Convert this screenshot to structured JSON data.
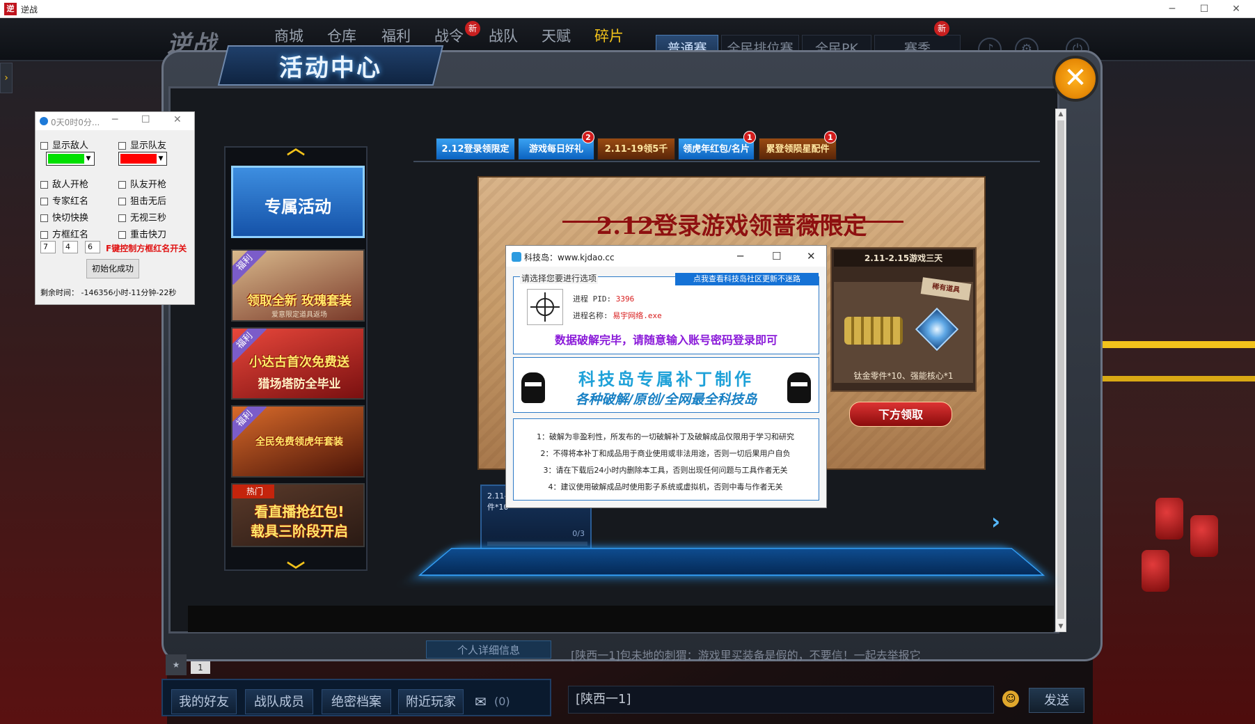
{
  "window": {
    "title": "逆战",
    "icon_text": "逆",
    "min": "─",
    "max": "☐",
    "close": "✕"
  },
  "topnav": {
    "logo": "逆战",
    "items": [
      "商城",
      "仓库",
      "福利",
      "战令",
      "战队",
      "天赋",
      "碎片"
    ],
    "new_badge": "新",
    "modes": [
      "普通赛",
      "全民排位赛",
      "全民PK",
      "赛季"
    ]
  },
  "activity": {
    "title": "活动中心",
    "close": "✕",
    "side": {
      "selected": "专属活动",
      "items": [
        {
          "tag": "福利",
          "text": "领取全新 玫瑰套装",
          "sub": "爱意限定道具返场"
        },
        {
          "tag": "福利",
          "text": "小达古首次免费送",
          "sub": "猎场塔防全毕业"
        },
        {
          "tag": "福利",
          "text": "全民免费领虎年套装",
          "sub": ""
        },
        {
          "tag": "热门",
          "text": "看直播抢红包!",
          "sub": "载具三阶段开启"
        }
      ]
    },
    "tabs": [
      {
        "label": "2.12登录领限定",
        "badge": ""
      },
      {
        "label": "游戏每日好礼",
        "badge": "2"
      },
      {
        "label": "2.11-19领5千",
        "badge": ""
      },
      {
        "label": "领虎年红包/名片",
        "badge": "1"
      },
      {
        "label": "累登领陨星配件",
        "badge": "1"
      }
    ],
    "banner": {
      "title": "2.12登录游戏领蔷薇限定",
      "panel_head": "2.11-2.15游戏三天",
      "rare_tag": "稀有道具",
      "reward": "钛金零件*10、强能核心*1",
      "claim": "下方领取"
    },
    "task_card": {
      "line1": "2.11-",
      "line2": "件*10",
      "progress": "0/3"
    }
  },
  "social": {
    "buttons": [
      "我的好友",
      "战队成员",
      "绝密档案",
      "附近玩家"
    ],
    "mail_count": "(0)",
    "detail": "个人详细信息",
    "level": "1"
  },
  "chat": {
    "line": "[陕西一1]包未地的刺猬：游戏里买装备是假的，不要信！一起去举报它",
    "input": "[陕西一1]",
    "send": "发送"
  },
  "tool": {
    "title": "0天0时0分...",
    "checks": [
      "显示敌人",
      "显示队友",
      "敌人开枪",
      "队友开枪",
      "专家红名",
      "狙击无后",
      "快切快换",
      "无视三秒",
      "方框红名",
      "重击快刀"
    ],
    "colors": {
      "enemy": "#00e000",
      "team": "#ff0000"
    },
    "inputs": [
      "7",
      "4",
      "6"
    ],
    "f_hint": "F键控制方框红名开关",
    "init_btn": "初始化成功",
    "remain": "剩余时间：  -146356小时-11分钟-22秒"
  },
  "popup": {
    "title": "科技岛：www.kjdao.cc",
    "group_label": "请选择您要进行选项",
    "link": "点我查看科技岛社区更新不迷路",
    "pid_label": "进程 PID:",
    "pid_value": "3396",
    "name_label": "进程名称:",
    "name_value": "易宇网络.exe",
    "crack_msg": "数据破解完毕，请随意输入账号密码登录即可",
    "ad_title": "科技岛专属补丁制作",
    "ad_sub": "各种破解/原创/全网最全科技岛",
    "notices": [
      "1：破解为非盈利性，所发布的一切破解补丁及破解成品仅限用于学习和研究",
      "2：不得将本补丁和成品用于商业使用或非法用途，否则一切后果用户自负",
      "3：请在下载后24小时内删除本工具，否则出现任何问题与工具作者无关",
      "4：建议使用破解成品时使用影子系统或虚拟机，否则中毒与作者无关"
    ]
  }
}
